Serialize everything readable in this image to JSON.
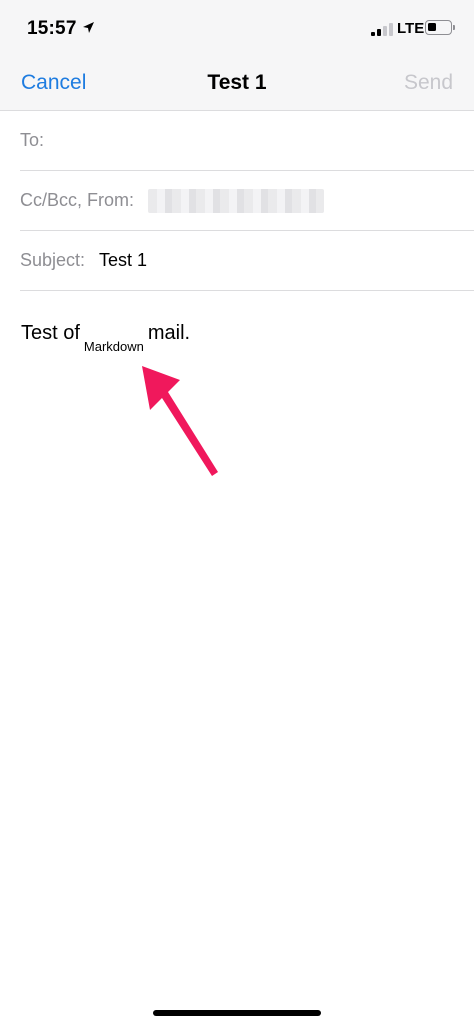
{
  "status_bar": {
    "time": "15:57",
    "network": "LTE",
    "battery_percent": 40
  },
  "nav": {
    "cancel_label": "Cancel",
    "title": "Test 1",
    "send_label": "Send"
  },
  "fields": {
    "to_label": "To:",
    "to_value": "",
    "ccbcc_label": "Cc/Bcc, From:",
    "subject_label": "Subject:",
    "subject_value": "Test 1"
  },
  "body": {
    "prefix": "Test of",
    "subscript": "Markdown",
    "suffix": "mail."
  },
  "colors": {
    "accent": "#1e7ce0",
    "disabled": "#c7c7cc",
    "arrow": "#f0185c"
  }
}
